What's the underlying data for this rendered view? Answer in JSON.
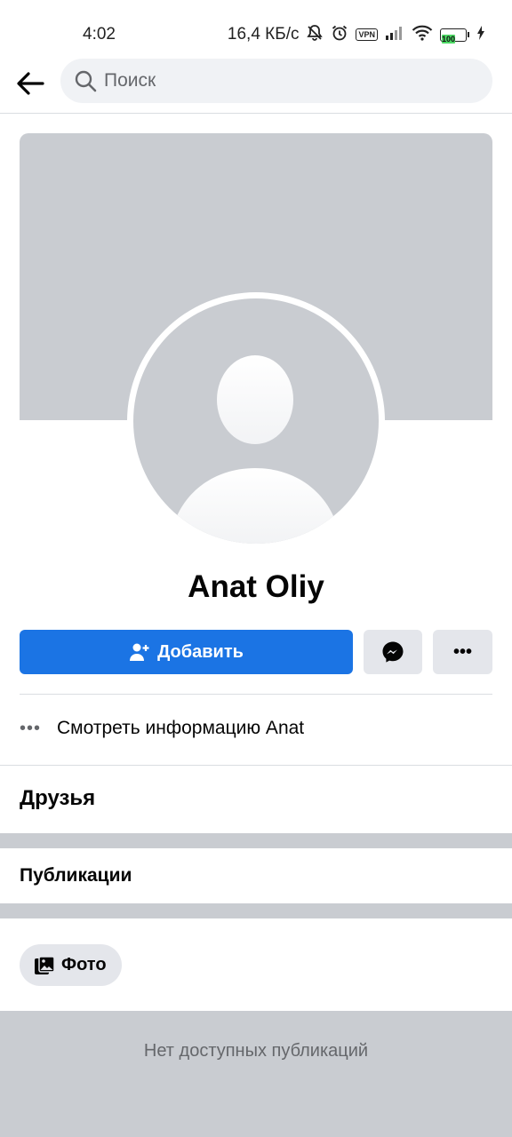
{
  "status_bar": {
    "time": "4:02",
    "network_speed": "16,4 КБ/с",
    "vpn_label": "VPN",
    "battery_level": "100",
    "icons": [
      "mute-bell-icon",
      "alarm-icon",
      "vpn-icon",
      "signal-icon",
      "wifi-icon",
      "battery-icon",
      "charging-icon"
    ]
  },
  "header": {
    "back_icon": "arrow-left-icon",
    "search_icon": "search-icon",
    "search_placeholder": "Поиск"
  },
  "profile": {
    "name": "Anat Oliy"
  },
  "actions": {
    "add_label": "Добавить",
    "add_icon": "add-friend-icon",
    "messenger_icon": "messenger-icon",
    "more_icon": "more-horizontal-icon",
    "more_label": "•••"
  },
  "info": {
    "dots": "•••",
    "label": "Смотреть информацию Anat"
  },
  "sections": {
    "friends_title": "Друзья",
    "posts_title": "Публикации"
  },
  "filters": {
    "photo_label": "Фото",
    "photo_icon": "photos-icon"
  },
  "empty_state": {
    "text": "Нет доступных публикаций"
  },
  "colors": {
    "primary": "#1b74e4",
    "placeholder_gray": "#c9ccd1",
    "button_gray": "#e4e6eb",
    "secondary_text": "#65676b"
  }
}
